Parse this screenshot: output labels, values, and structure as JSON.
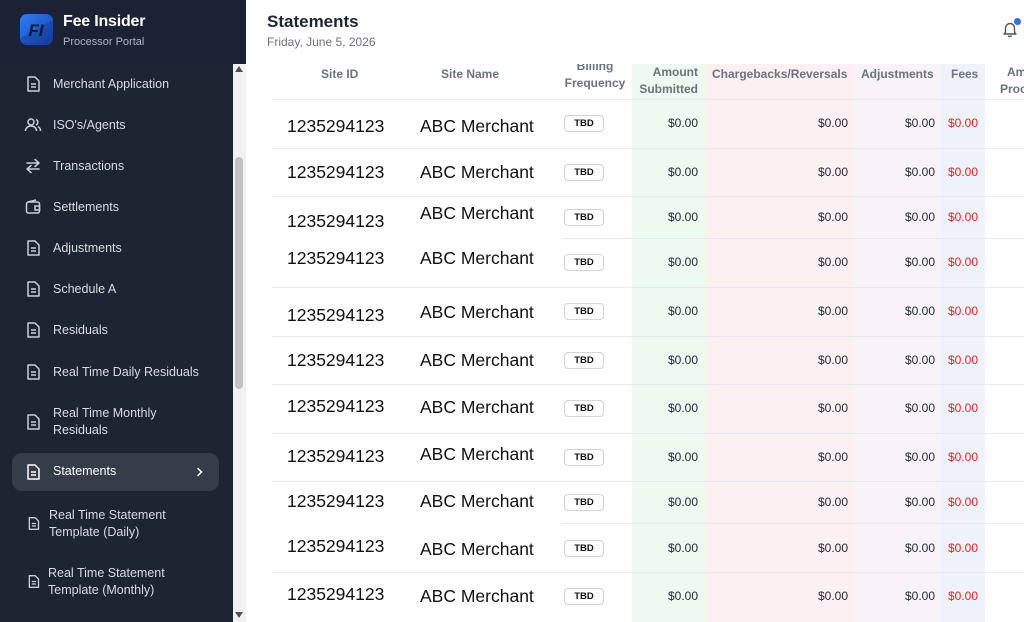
{
  "brand": {
    "title": "Fee Insider",
    "subtitle": "Processor Portal",
    "logo_text": "FI"
  },
  "header": {
    "title": "Statements",
    "date": "Friday, June 5, 2026"
  },
  "sidebar": {
    "items": [
      {
        "label": "Merchant Application",
        "icon": "document-icon"
      },
      {
        "label": "ISO's/Agents",
        "icon": "users-icon"
      },
      {
        "label": "Transactions",
        "icon": "arrows-swap-icon"
      },
      {
        "label": "Settlements",
        "icon": "wallet-icon"
      },
      {
        "label": "Adjustments",
        "icon": "document-icon"
      },
      {
        "label": "Schedule A",
        "icon": "document-icon"
      },
      {
        "label": "Residuals",
        "icon": "document-icon"
      },
      {
        "label": "Real Time Daily Residuals",
        "icon": "document-icon"
      },
      {
        "label": "Real Time Monthly Residuals",
        "icon": "document-icon"
      },
      {
        "label": "Statements",
        "icon": "document-icon",
        "active": true
      },
      {
        "label": "Real Time Statement Template (Daily)",
        "icon": "document-icon"
      },
      {
        "label": "Real Time Statement Template (Monthly)",
        "icon": "document-icon"
      }
    ]
  },
  "table": {
    "columns": [
      "Site ID",
      "Site Name",
      "Billing Frequency",
      "Amount Submitted",
      "Chargebacks/Reversals",
      "Adjustments",
      "Fees",
      "Amount Processed"
    ],
    "visible_header_fragments": {
      "billing_line1": "Billing",
      "billing_line2": "Frequency",
      "amount_line1": "Amount",
      "amount_line2": "Submitted",
      "processed_line1": "Am",
      "processed_line2": "Proc"
    },
    "rows": [
      {
        "site_id": "1235294123",
        "site_name": "ABC Merchant",
        "billing": "TBD",
        "amount": "$0.00",
        "chargebacks": "$0.00",
        "adjustments": "$0.00",
        "fees": "$0.00"
      },
      {
        "site_id": "1235294123",
        "site_name": "ABC Merchant",
        "billing": "TBD",
        "amount": "$0.00",
        "chargebacks": "$0.00",
        "adjustments": "$0.00",
        "fees": "$0.00"
      },
      {
        "site_id": "1235294123",
        "site_name": "ABC Merchant",
        "billing": "TBD",
        "amount": "$0.00",
        "chargebacks": "$0.00",
        "adjustments": "$0.00",
        "fees": "$0.00"
      },
      {
        "site_id": "1235294123",
        "site_name": "ABC Merchant",
        "billing": "TBD",
        "amount": "$0.00",
        "chargebacks": "$0.00",
        "adjustments": "$0.00",
        "fees": "$0.00"
      },
      {
        "site_id": "1235294123",
        "site_name": "ABC Merchant",
        "billing": "TBD",
        "amount": "$0.00",
        "chargebacks": "$0.00",
        "adjustments": "$0.00",
        "fees": "$0.00"
      },
      {
        "site_id": "1235294123",
        "site_name": "ABC Merchant",
        "billing": "TBD",
        "amount": "$0.00",
        "chargebacks": "$0.00",
        "adjustments": "$0.00",
        "fees": "$0.00"
      },
      {
        "site_id": "1235294123",
        "site_name": "ABC Merchant",
        "billing": "TBD",
        "amount": "$0.00",
        "chargebacks": "$0.00",
        "adjustments": "$0.00",
        "fees": "$0.00"
      },
      {
        "site_id": "1235294123",
        "site_name": "ABC Merchant",
        "billing": "TBD",
        "amount": "$0.00",
        "chargebacks": "$0.00",
        "adjustments": "$0.00",
        "fees": "$0.00"
      },
      {
        "site_id": "1235294123",
        "site_name": "ABC Merchant",
        "billing": "TBD",
        "amount": "$0.00",
        "chargebacks": "$0.00",
        "adjustments": "$0.00",
        "fees": "$0.00"
      },
      {
        "site_id": "1235294123",
        "site_name": "ABC Merchant",
        "billing": "TBD",
        "amount": "$0.00",
        "chargebacks": "$0.00",
        "adjustments": "$0.00",
        "fees": "$0.00"
      },
      {
        "site_id": "1235294123",
        "site_name": "ABC Merchant",
        "billing": "TBD",
        "amount": "$0.00",
        "chargebacks": "$0.00",
        "adjustments": "$0.00",
        "fees": "$0.00"
      }
    ]
  },
  "colors": {
    "sidebar_bg": "#1e2532",
    "active_item_bg": "#353d4b",
    "fees_text": "#dc2626",
    "amount_col_bg": "#eef9ef",
    "chargebacks_col_bg": "#fdf0f2",
    "adjustments_col_bg": "#f8f3f9",
    "fees_col_bg": "#eef3fb"
  }
}
